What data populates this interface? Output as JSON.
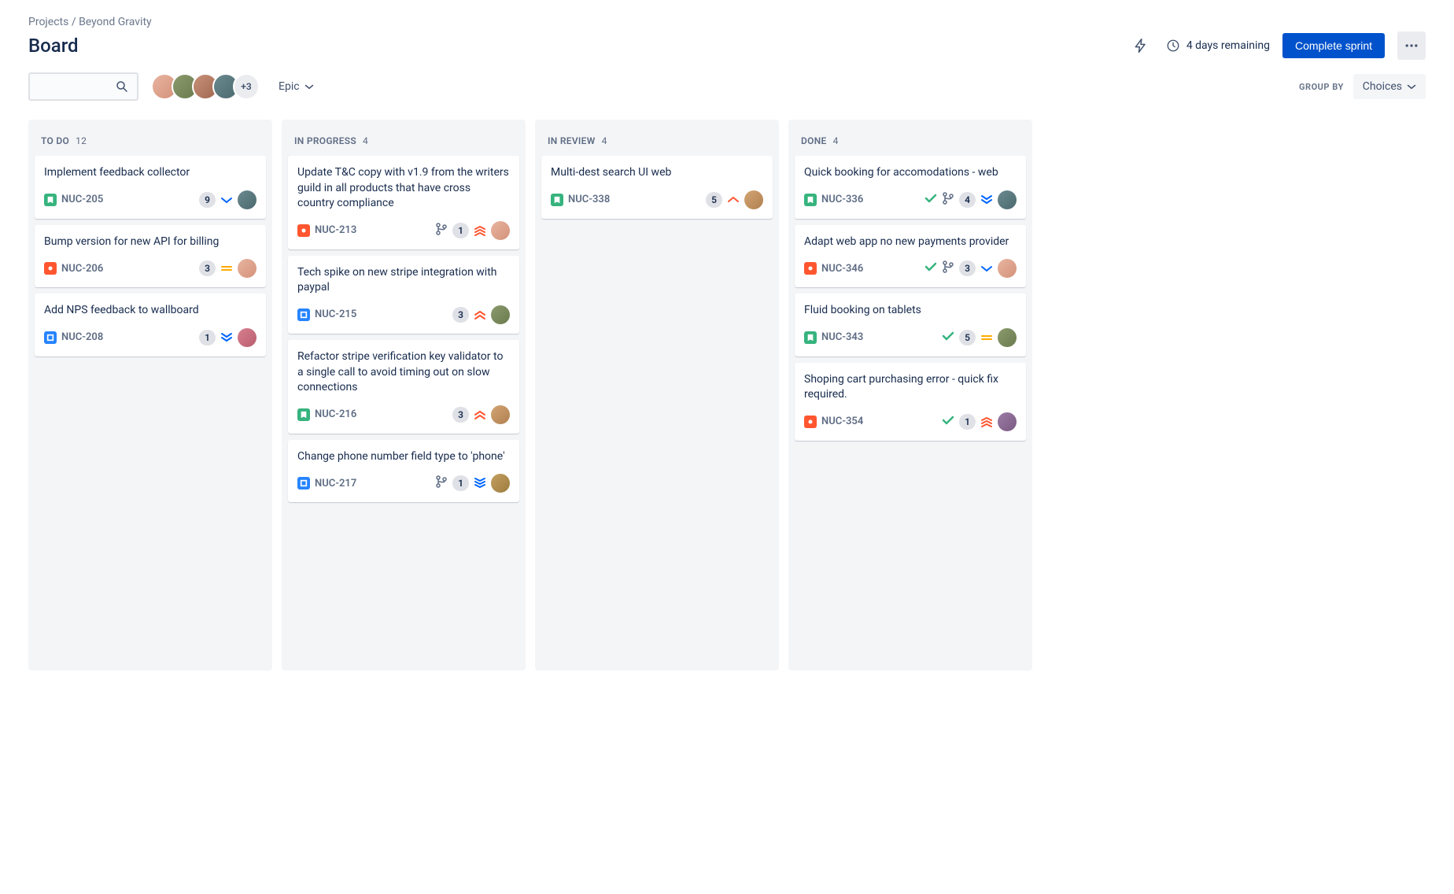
{
  "breadcrumb": {
    "root": "Projects",
    "project": "Beyond Gravity"
  },
  "page_title": "Board",
  "header": {
    "remaining_text": "4 days remaining",
    "complete_label": "Complete sprint"
  },
  "toolbar": {
    "avatar_more": "+3",
    "epic_label": "Epic",
    "group_by_label": "GROUP BY",
    "choices_label": "Choices"
  },
  "columns": [
    {
      "title": "TO DO",
      "count": "12"
    },
    {
      "title": "IN PROGRESS",
      "count": "4"
    },
    {
      "title": "IN REVIEW",
      "count": "4"
    },
    {
      "title": "DONE",
      "count": "4"
    }
  ],
  "cards": {
    "c0": {
      "title": "Implement feedback collector",
      "key": "NUC-205",
      "badge": "9"
    },
    "c1": {
      "title": "Bump version for new API for billing",
      "key": "NUC-206",
      "badge": "3"
    },
    "c2": {
      "title": "Add NPS feedback to wallboard",
      "key": "NUC-208",
      "badge": "1"
    },
    "c3": {
      "title": "Update T&C copy with v1.9 from the writers guild in all products that have cross country compliance",
      "key": "NUC-213",
      "badge": "1"
    },
    "c4": {
      "title": "Tech spike on new stripe integration with paypal",
      "key": "NUC-215",
      "badge": "3"
    },
    "c5": {
      "title": "Refactor stripe verification key validator to a single call to avoid timing out on slow connections",
      "key": "NUC-216",
      "badge": "3"
    },
    "c6": {
      "title": "Change phone number field type to 'phone'",
      "key": "NUC-217",
      "badge": "1"
    },
    "c7": {
      "title": "Multi-dest search UI web",
      "key": "NUC-338",
      "badge": "5"
    },
    "c8": {
      "title": "Quick booking for accomodations - web",
      "key": "NUC-336",
      "badge": "4"
    },
    "c9": {
      "title": "Adapt web app no new payments provider",
      "key": "NUC-346",
      "badge": "3"
    },
    "c10": {
      "title": "Fluid booking on tablets",
      "key": "NUC-343",
      "badge": "5"
    },
    "c11": {
      "title": "Shoping cart purchasing error - quick fix required.",
      "key": "NUC-354",
      "badge": "1"
    }
  }
}
